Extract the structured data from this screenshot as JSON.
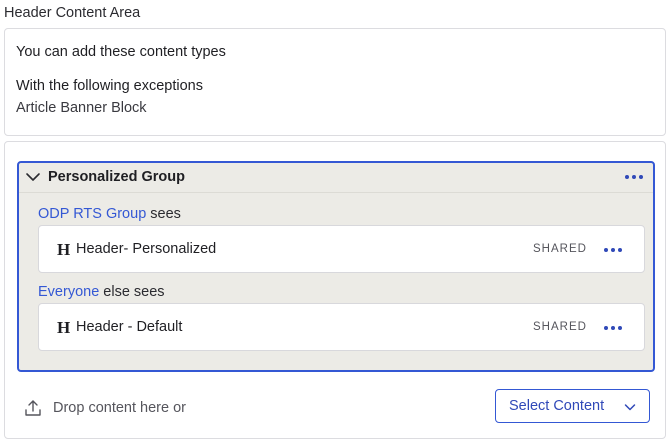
{
  "content_area": {
    "title": "Header Content Area",
    "allowed_heading": "You can add these content types",
    "exceptions_heading": "With the following exceptions",
    "exception_item": "Article Banner Block"
  },
  "group": {
    "title": "Personalized Group",
    "icon": "chevron-down-icon",
    "variants": [
      {
        "audience": "ODP RTS Group",
        "suffix": " sees",
        "block_icon": "H",
        "block_name": "Header- Personalized",
        "badge": "SHARED"
      },
      {
        "audience": "Everyone",
        "suffix": " else sees",
        "block_icon": "H",
        "block_name": "Header - Default",
        "badge": "SHARED"
      }
    ]
  },
  "drop_zone": {
    "text": "Drop content here or",
    "icon": "upload-icon"
  },
  "select_content": {
    "label": "Select Content",
    "icon": "chevron-down-icon"
  },
  "colors": {
    "accent": "#3458d4",
    "group_background": "#ecebe6",
    "border": "#dcdce0"
  }
}
